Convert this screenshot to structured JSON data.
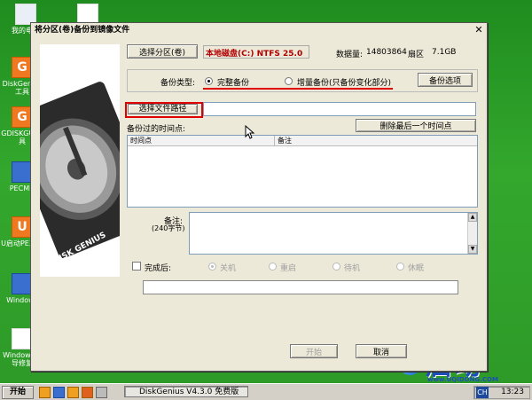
{
  "desktop": {
    "icons": [
      {
        "label": "我的电脑"
      },
      {
        "label": "DiskGenius工具"
      },
      {
        "label": "GDISKGUI工具"
      },
      {
        "label": "PECMD"
      },
      {
        "label": "U启动PE工具"
      },
      {
        "label": "Windows"
      },
      {
        "label": "Windows引导修复"
      }
    ],
    "watermark_text": "启动",
    "watermark_url": "www.UQIDONG.COM"
  },
  "dialog": {
    "title": "将分区(卷)备份到镜像文件",
    "select_partition_button": "选择分区(卷)",
    "partition_info": "本地磁盘(C:) NTFS 25.0",
    "sector_count_label": "数据量:",
    "sector_count_value": "14803864",
    "sector_label": "扇区",
    "size_value": "7.1GB",
    "backup_type_label": "备份类型:",
    "full_backup_label": "完整备份",
    "incremental_backup_label": "增量备份(只备份变化部分)",
    "backup_options_button": "备份选项",
    "select_file_path_button": "选择文件路径",
    "file_path_value": "",
    "history_label": "备份过的时间点:",
    "delete_last_button": "删除最后一个时间点",
    "table_columns": [
      "时间点",
      "备注"
    ],
    "note_label": "备注:",
    "note_hint": "(240字节)",
    "note_value": "",
    "after_complete_label": "完成后:",
    "after_options": [
      "关机",
      "重启",
      "待机",
      "休眠"
    ],
    "start_button": "开始",
    "cancel_button": "取消"
  },
  "taskbar": {
    "start_label": "开始",
    "task_label": "DiskGenius V4.3.0 免费版",
    "time": "13:23",
    "lang": "CH"
  }
}
